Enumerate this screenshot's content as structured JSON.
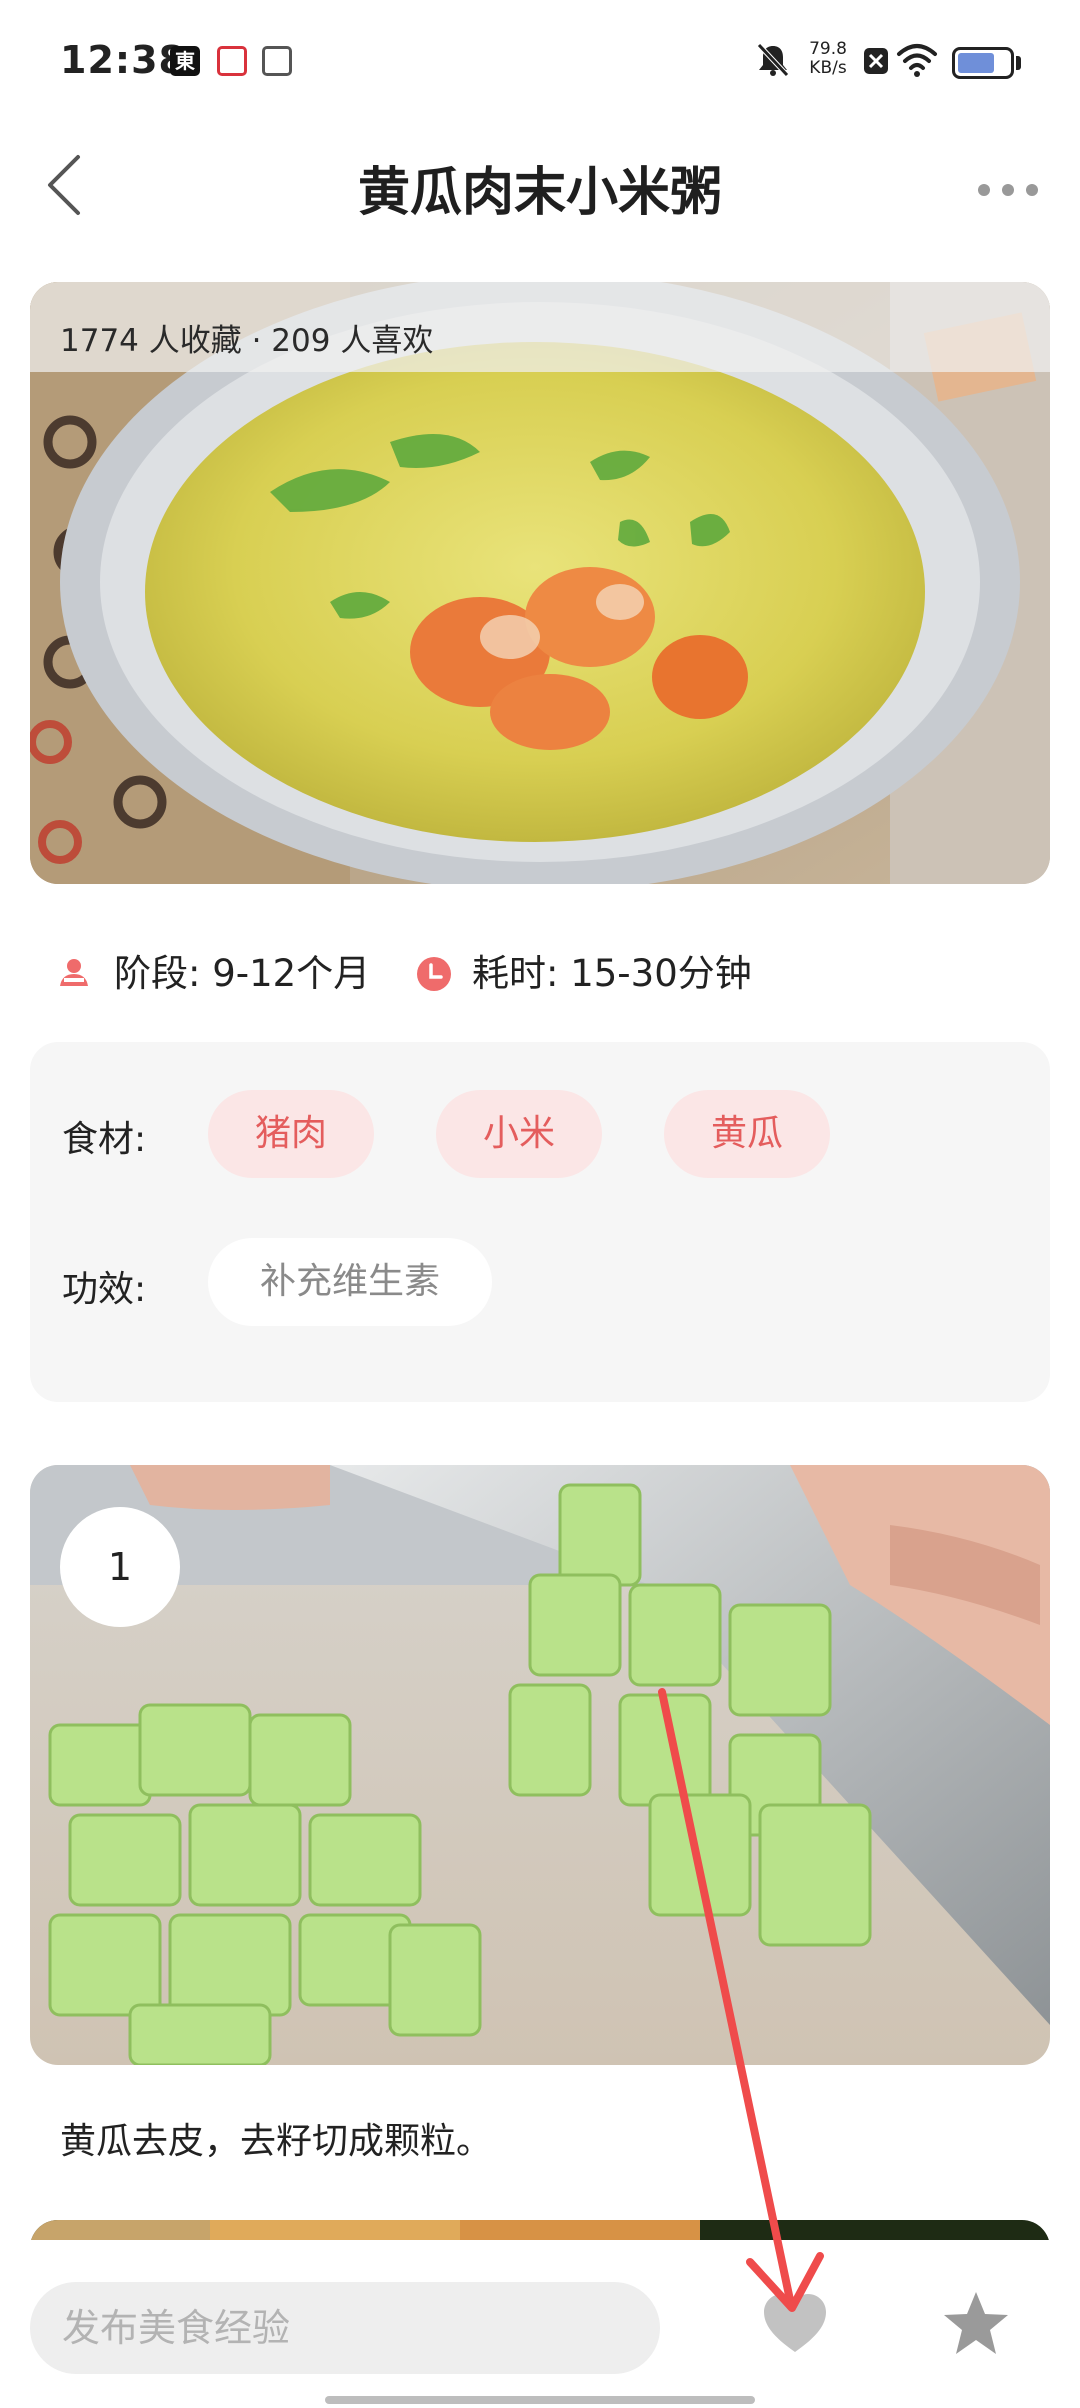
{
  "status_bar": {
    "time": "12:38",
    "app_icons": [
      "jd-app-icon",
      "red-app-icon",
      "gray-app-icon"
    ],
    "network_speed": "79.8",
    "network_unit": "KB/s",
    "battery_level": 0.72
  },
  "header": {
    "title": "黄瓜肉末小米粥",
    "back_icon": "chevron-left-icon",
    "more_icon": "more-horizontal-icon"
  },
  "hero": {
    "stats": "1774 人收藏 · 209 人喜欢"
  },
  "meta": {
    "stage": "阶段: 9-12个月",
    "time": "耗时: 15-30分钟"
  },
  "info": {
    "ingredients_label": "食材:",
    "ingredients": [
      "猪肉",
      "小米",
      "黄瓜"
    ],
    "effects_label": "功效:",
    "effects": [
      "补充维生素"
    ]
  },
  "steps": [
    {
      "number": "1",
      "text": "黄瓜去皮，去籽切成颗粒。"
    }
  ],
  "bottom_bar": {
    "comment_placeholder": "发布美食经验",
    "like_icon": "heart-icon",
    "favorite_icon": "star-icon"
  },
  "colors": {
    "accent": "#e45d5d",
    "tag_bg": "#fbe6e6",
    "annotation": "#ef4b4b"
  }
}
